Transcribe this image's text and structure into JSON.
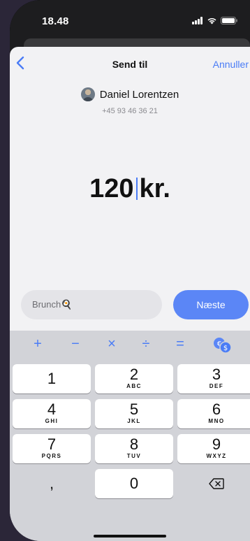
{
  "status": {
    "time": "18.48",
    "icons": [
      "signal-icon",
      "wifi-icon",
      "battery-icon"
    ]
  },
  "nav": {
    "back_icon": "chevron-left-icon",
    "title": "Send til",
    "cancel": "Annuller"
  },
  "recipient": {
    "name": "Daniel Lorentzen",
    "phone": "+45 93 46 36 21"
  },
  "amount": {
    "value": "120",
    "currency": "kr."
  },
  "message": {
    "value": "Brunch🍳"
  },
  "actions": {
    "next": "Næste"
  },
  "keyboard": {
    "operators": [
      "+",
      "−",
      "×",
      "÷",
      "="
    ],
    "keys": [
      {
        "num": "1",
        "letters": ""
      },
      {
        "num": "2",
        "letters": "ABC"
      },
      {
        "num": "3",
        "letters": "DEF"
      },
      {
        "num": "4",
        "letters": "GHI"
      },
      {
        "num": "5",
        "letters": "JKL"
      },
      {
        "num": "6",
        "letters": "MNO"
      },
      {
        "num": "7",
        "letters": "PQRS"
      },
      {
        "num": "8",
        "letters": "TUV"
      },
      {
        "num": "9",
        "letters": "WXYZ"
      },
      {
        "num": ",",
        "letters": ""
      },
      {
        "num": "0",
        "letters": ""
      }
    ]
  },
  "colors": {
    "accent": "#4a7cf6",
    "button": "#5b86f6",
    "sheet": "#f2f2f4",
    "keyboard": "#d2d3d8"
  }
}
